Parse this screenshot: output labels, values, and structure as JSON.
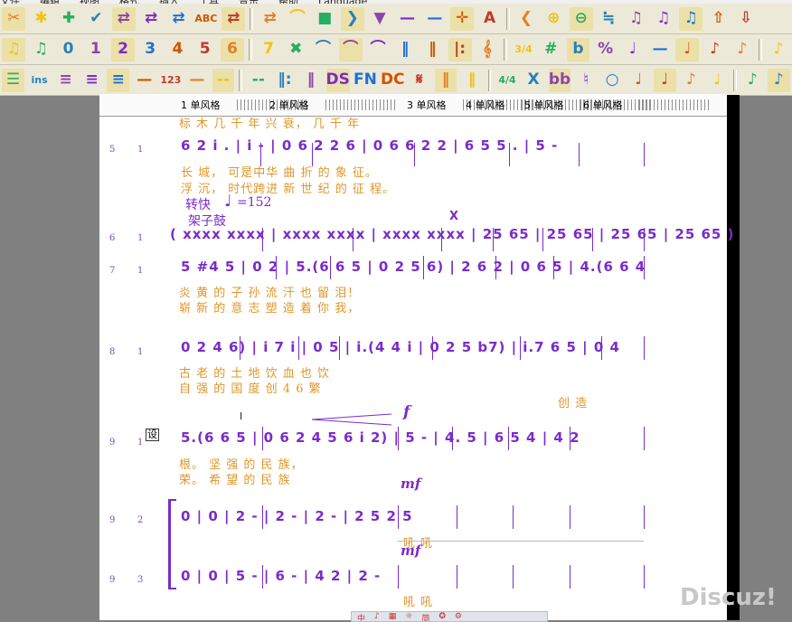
{
  "menu": [
    "文件",
    "编辑",
    "视图",
    "格式",
    "插入",
    "工具",
    "音乐",
    "帮助",
    "Language"
  ],
  "toolbars": {
    "row1": [
      "✂",
      "✱",
      "✚",
      "✔",
      "⇄",
      "⇄",
      "⇄",
      "ABC",
      "⇄",
      "⇄",
      "⌒",
      "■",
      "❯",
      "▼",
      "—",
      "—",
      "✛",
      "A",
      "❮",
      "⊕",
      "⊖",
      "≒",
      "♫",
      "♫",
      "♫",
      "⇧",
      "⇩"
    ],
    "row2": [
      "♫",
      "♫",
      "0",
      "1",
      "2",
      "3",
      "4",
      "5",
      "6",
      "7",
      "✖",
      "⌒",
      "⌒",
      "⌒",
      "‖",
      "‖",
      "|:",
      "𝄞",
      "3/4",
      "#",
      "b",
      "%",
      "♩",
      "—",
      "♩",
      "♪",
      "♪",
      "♪"
    ],
    "row3_label": "ins",
    "row3": [
      "☰",
      "ins",
      "≡",
      "≡",
      "≡",
      "—",
      "123",
      "—",
      "--",
      "--",
      "‖:",
      "‖",
      "DS",
      "FN",
      "DC",
      "𝄋",
      "‖",
      "‖",
      "4/4",
      "X",
      "bb",
      "♮",
      "○",
      "♩",
      "♩",
      "♪",
      "♩",
      "♪",
      "♪"
    ]
  },
  "ruler": {
    "segments": [
      "1 单风格",
      "2 单风格",
      "3 单风格",
      "4 单风格",
      "5 单风格",
      "6 单风格"
    ]
  },
  "score": {
    "top_lyric": "标      木                    几 千 年   兴 衰，          几 千 年",
    "rows": [
      {
        "part": "5",
        "voice": "1",
        "notes": "6 2 i .   | i  -   | 0 6 2 2 6 | 0 6  6 2 2 | 6 5 5 .  | 5  -",
        "lyric1": "长  城，                     可是中华      曲 折 的        象   征。",
        "lyric2": "浮  沉，                     时代跨进      新 世 纪 的     征   程。"
      },
      {
        "part": "6",
        "voice": "1",
        "tempo": "转快",
        "tempo_value": "=152",
        "instrument": "架子鼓",
        "marker": "X",
        "notes": "( xxxx xxxx | xxxx xxxx | xxxx xxxx | 25 65 | 25 65 | 25 65 | 25 65 )"
      },
      {
        "part": "7",
        "voice": "1",
        "notes": "5 #4 5 | 0 2 | 5.(6 6 5 | 0 2 5 6) | 2 6 2 | 0 6 5 | 4.(6 6 4",
        "lyric1": "炎  黄 的          子  孙                                      流 汗 也       留    泪！",
        "lyric2": "崭  新 的          意  志                                      塑 造 着       你    我，"
      },
      {
        "part": "8",
        "voice": "1",
        "notes": "0 2 4 6) | i 7 i | 0 5 | i.(4 4 i | 0 2 5 b7) | i.7 6 5 | 0 4",
        "lyric1": "                 古 老 的      土   地                                     饮      血 也       饮",
        "lyric2": "                 自 强 的      国   度                                     创    4 6       繁",
        "lyric3": "创 造"
      },
      {
        "part": "9",
        "voice": "1",
        "dynamic": "f",
        "cursor": "I",
        "notes": "5.(6 6 5 | 0 6  2 4 5 6 i 2) | 5  - | 4. 5 | 6 5 4 | 4  2",
        "lyric1": "根。                                      坚        强  的  民  族，",
        "lyric2": "荣。                                      希        望  的  民  族"
      },
      {
        "part": "9",
        "voice": "2",
        "dynamic": "mf",
        "notes": "0 | 0 | 2  - | 2  - | 2  - | 2 5  2 5",
        "lyric1": "吼                                     吼"
      },
      {
        "part": "9",
        "voice": "3",
        "dynamic": "mf",
        "notes": "0 | 0 | 5  - | 6  - | 4  2 | 2  -",
        "lyric1": "吼              吼"
      }
    ]
  },
  "watermark": "Discuz!",
  "taskbar": [
    "中",
    "♪",
    "▦",
    "☼",
    "简",
    "✪",
    "⚙"
  ],
  "colors": {
    "note": "#7a2cc9",
    "lyric": "#e0962a",
    "toolbar": "#ece9d8",
    "background": "#808080"
  }
}
